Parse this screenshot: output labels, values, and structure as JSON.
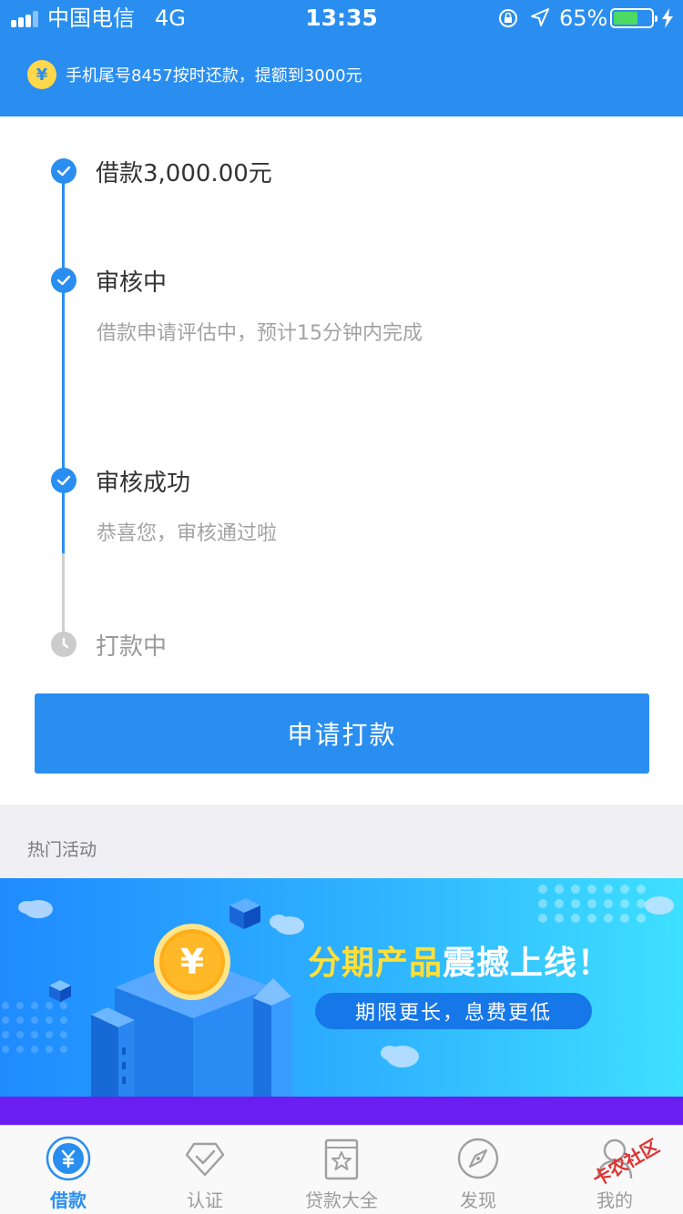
{
  "status_bar": {
    "carrier": "中国电信",
    "network": "4G",
    "time": "13:35",
    "battery_percent": "65%",
    "battery_level": 0.65,
    "icons": [
      "signal-icon",
      "rotation-lock-icon",
      "location-arrow-icon",
      "battery-icon",
      "charging-bolt-icon"
    ]
  },
  "notice": {
    "icon": "yen-coin-icon",
    "text": "手机尾号8457按时还款，提额到3000元"
  },
  "timeline": {
    "steps": [
      {
        "title": "借款3,000.00元",
        "desc": "",
        "state": "done"
      },
      {
        "title": "审核中",
        "desc": "借款申请评估中，预计15分钟内完成",
        "state": "done"
      },
      {
        "title": "审核成功",
        "desc": "恭喜您，审核通过啦",
        "state": "done"
      },
      {
        "title": "打款中",
        "desc": "",
        "state": "pending"
      }
    ]
  },
  "apply_button": {
    "label": "申请打款"
  },
  "hot": {
    "title": "热门活动"
  },
  "banner": {
    "title_highlight": "分期产品",
    "title_rest": "震撼上线！",
    "pill": "期限更长，息费更低",
    "coin_symbol": "¥"
  },
  "tabbar": {
    "items": [
      {
        "label": "借款",
        "icon": "loan-yen-icon",
        "active": true
      },
      {
        "label": "认证",
        "icon": "verify-check-icon",
        "active": false
      },
      {
        "label": "贷款大全",
        "icon": "loan-catalog-icon",
        "active": false
      },
      {
        "label": "发现",
        "icon": "compass-icon",
        "active": false
      },
      {
        "label": "我的",
        "icon": "profile-icon",
        "active": false
      }
    ]
  },
  "watermark": {
    "text": "卡农社区"
  },
  "colors": {
    "primary": "#2a8ef0",
    "muted_text": "#a3a3a3",
    "highlight": "#ffe03a",
    "strip": "#6a1ff0"
  }
}
